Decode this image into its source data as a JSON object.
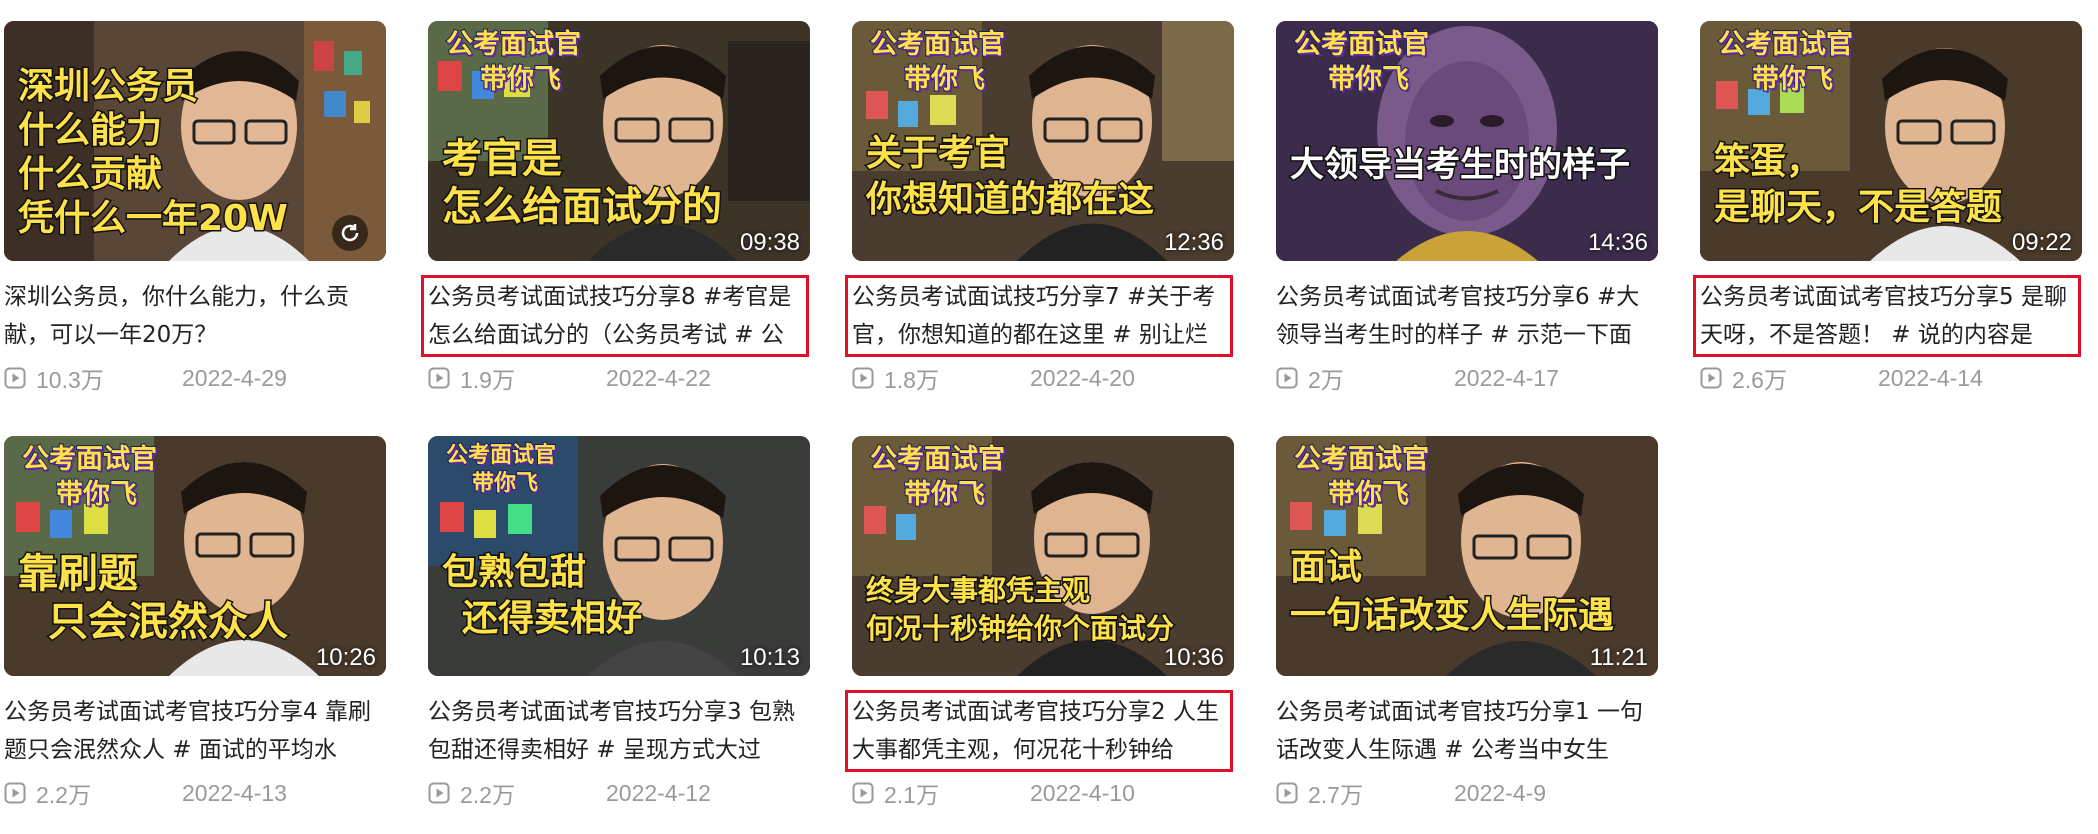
{
  "cards": [
    {
      "brand": [
        "",
        ""
      ],
      "overlay": [
        "深圳公务员",
        "什么能力",
        "什么贡献",
        "凭什么一年20W"
      ],
      "duration": "",
      "title": "深圳公务员，你什么能力，什么贡献，可以一年20万？",
      "views": "10.3万",
      "date": "2022-4-29"
    },
    {
      "brand": [
        "公考面试官",
        "带你飞"
      ],
      "overlay": [
        "考官是",
        "怎么给面试分的"
      ],
      "duration": "09:38",
      "title": "公务员考试面试技巧分享8 #考官是怎么给面试分的（公务员考试 # 公",
      "views": "1.9万",
      "date": "2022-4-22"
    },
    {
      "brand": [
        "公考面试官",
        "带你飞"
      ],
      "overlay": [
        "关于考官",
        "你想知道的都在这"
      ],
      "duration": "12:36",
      "title": "公务员考试面试技巧分享7 #关于考官，你想知道的都在这里 # 别让烂",
      "views": "1.8万",
      "date": "2022-4-20"
    },
    {
      "brand": [
        "公考面试官",
        "带你飞"
      ],
      "overlay": [
        "大领导当考生时的样子"
      ],
      "duration": "14:36",
      "title": "公务员考试面试考官技巧分享6 #大领导当考生时的样子 # 示范一下面",
      "views": "2万",
      "date": "2022-4-17"
    },
    {
      "brand": [
        "公考面试官",
        "带你飞"
      ],
      "overlay": [
        "笨蛋，",
        "是聊天，不是答题"
      ],
      "duration": "09:22",
      "title": "公务员考试面试考官技巧分享5 是聊天呀，不是答题！ # 说的内容是",
      "views": "2.6万",
      "date": "2022-4-14"
    },
    {
      "brand": [
        "公考面试官",
        "带你飞"
      ],
      "overlay": [
        "靠刷题",
        "只会泯然众人"
      ],
      "duration": "10:26",
      "title": "公务员考试面试考官技巧分享4 靠刷题只会泯然众人 # 面试的平均水",
      "views": "2.2万",
      "date": "2022-4-13"
    },
    {
      "brand": [
        "公考面试官",
        "带你飞"
      ],
      "overlay": [
        "包熟包甜",
        "还得卖相好"
      ],
      "duration": "10:13",
      "title": "公务员考试面试考官技巧分享3 包熟包甜还得卖相好 # 呈现方式大过",
      "views": "2.2万",
      "date": "2022-4-12"
    },
    {
      "brand": [
        "公考面试官",
        "带你飞"
      ],
      "overlay": [
        "终身大事都凭主观",
        "何况十秒钟给你个面试分"
      ],
      "duration": "10:36",
      "title": "公务员考试面试考官技巧分享2 人生大事都凭主观，何况花十秒钟给",
      "views": "2.1万",
      "date": "2022-4-10"
    },
    {
      "brand": [
        "公考面试官",
        "带你飞"
      ],
      "overlay": [
        "面试",
        "一句话改变人生际遇"
      ],
      "duration": "11:21",
      "title": "公务员考试面试考官技巧分享1 一句话改变人生际遇 # 公考当中女生",
      "views": "2.7万",
      "date": "2022-4-9"
    }
  ],
  "icons": {
    "play": "play-icon",
    "refresh": "refresh-icon"
  },
  "colors": {
    "highlight_border": "#e0102a",
    "meta_text": "#9a9a9a",
    "overlay_text": "#ffe14a"
  }
}
